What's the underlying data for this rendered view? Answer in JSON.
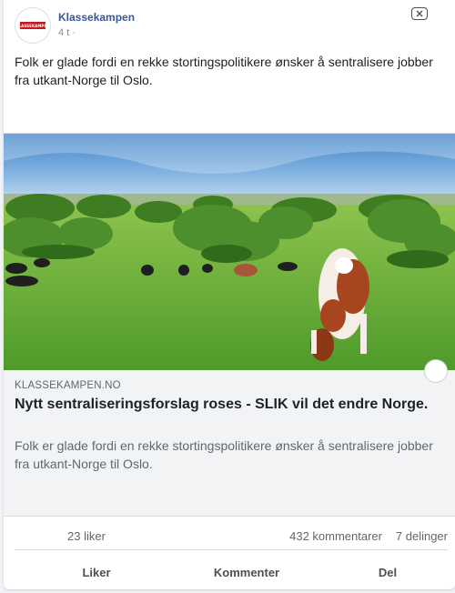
{
  "post": {
    "page_name": "Klassekampen",
    "avatar_logo_text": "KLASSEKAMPEN",
    "timestamp": "4 t",
    "timestamp_dot": "·",
    "text": "Folk er glade fordi en rekke stortingspolitikere ønsker å sentralisere jobber fra utkant-Norge til Oslo."
  },
  "link": {
    "domain": "KLASSEKAMPEN.NO",
    "title": "Nytt sentraliseringsforslag roses - SLIK vil det endre Norge.",
    "description": "Folk er glade fordi en rekke stortingspolitikere ønsker å sentralisere jobber fra utkant-Norge til Oslo."
  },
  "stats": {
    "likes": "23 liker",
    "comments": "432 kommentarer",
    "shares": "7 delinger"
  },
  "actions": {
    "like": "Liker",
    "comment": "Kommenter",
    "share": "Del"
  },
  "icons": {
    "close": "close-icon",
    "share_circle": "circle-button"
  },
  "colors": {
    "page_name": "#385898",
    "muted": "#606770"
  }
}
